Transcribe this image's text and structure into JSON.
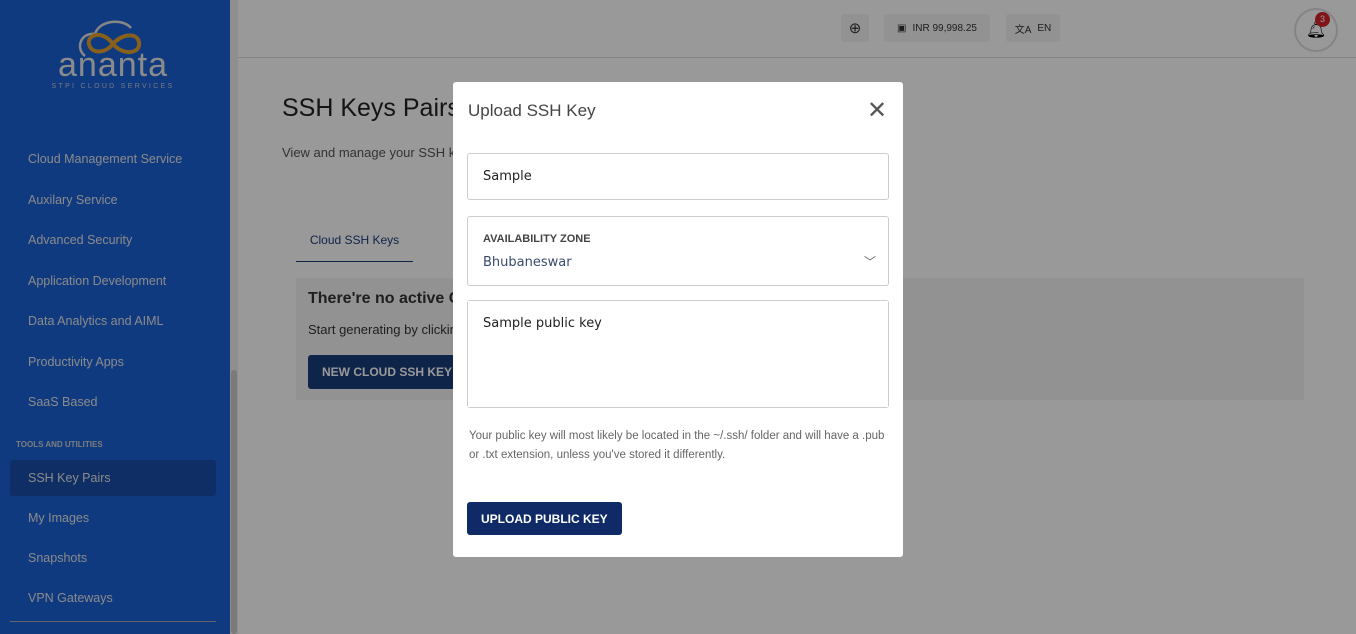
{
  "brand": {
    "name": "ananta",
    "tagline": "STPI CLOUD SERVICES"
  },
  "sidebar": {
    "items": [
      {
        "label": "Cloud Management Service"
      },
      {
        "label": "Auxilary Service"
      },
      {
        "label": "Advanced Security"
      },
      {
        "label": "Application Development"
      },
      {
        "label": "Data Analytics and AIML"
      },
      {
        "label": "Productivity Apps"
      },
      {
        "label": "SaaS Based"
      }
    ],
    "section_label": "TOOLS AND UTILITIES",
    "tools": [
      {
        "label": "SSH Key Pairs",
        "active": true
      },
      {
        "label": "My Images"
      },
      {
        "label": "Snapshots"
      },
      {
        "label": "VPN Gateways"
      }
    ]
  },
  "header": {
    "balance": "INR 99,998.25",
    "language": "EN",
    "notifications": "3"
  },
  "page": {
    "title": "SSH Keys Pairs",
    "description": "View and manage your SSH key pairs. Your SSH key pairs are stored on Ananta Cloud.",
    "tab": "Cloud SSH Keys",
    "empty_title": "There're no active Cloud SSH Keys",
    "empty_text": "Start generating by clicking the button below",
    "new_button": "NEW CLOUD SSH KEY"
  },
  "modal": {
    "title": "Upload SSH Key",
    "name_value": "Sample",
    "az_label": "AVAILABILITY ZONE",
    "az_value": "Bhubaneswar",
    "key_value": "Sample public key",
    "hint": "Your public key will most likely be located in the ~/.ssh/ folder and will have a .pub or .txt extension, unless you've stored it differently.",
    "upload_button": "UPLOAD PUBLIC KEY"
  },
  "colors": {
    "sidebar": "#1b61d6",
    "primary": "#0f2a66",
    "badge": "#d8222a"
  }
}
